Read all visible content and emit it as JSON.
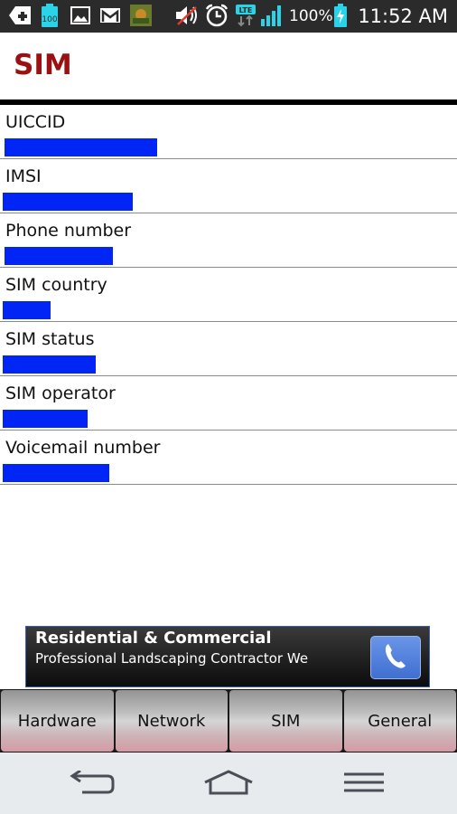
{
  "status_bar": {
    "icons": [
      "add-icon",
      "battery-saver-100-icon",
      "gallery-icon",
      "gmail-icon",
      "app-thumbnail-icon",
      "mute-icon",
      "alarm-icon",
      "lte-icon",
      "signal-icon",
      "battery-charging-icon"
    ],
    "battery_badge": "100",
    "lte_label": "LTE",
    "battery_percent": "100%",
    "time": "11:52 AM"
  },
  "header": {
    "title": "SIM"
  },
  "info": {
    "rows": [
      {
        "label": "UICCID",
        "value_redacted": true
      },
      {
        "label": "IMSI",
        "value_redacted": true
      },
      {
        "label": "Phone number",
        "value_redacted": true
      },
      {
        "label": "SIM country",
        "value_redacted": true
      },
      {
        "label": "SIM status",
        "value_redacted": true
      },
      {
        "label": "SIM operator",
        "value_redacted": true
      },
      {
        "label": "Voicemail number",
        "value_redacted": true
      }
    ]
  },
  "ad": {
    "title": "Residential & Commercial",
    "subtitle": "Professional Landscaping Contractor We",
    "call_icon": "phone-icon"
  },
  "tabs": [
    {
      "label": "Hardware"
    },
    {
      "label": "Network"
    },
    {
      "label": "SIM",
      "selected": true
    },
    {
      "label": "General"
    }
  ],
  "nav": {
    "buttons": [
      "back",
      "home",
      "menu"
    ]
  },
  "colors": {
    "title": "#9b1111",
    "redaction": "#0025f5",
    "status_accent": "#29d4e8"
  }
}
